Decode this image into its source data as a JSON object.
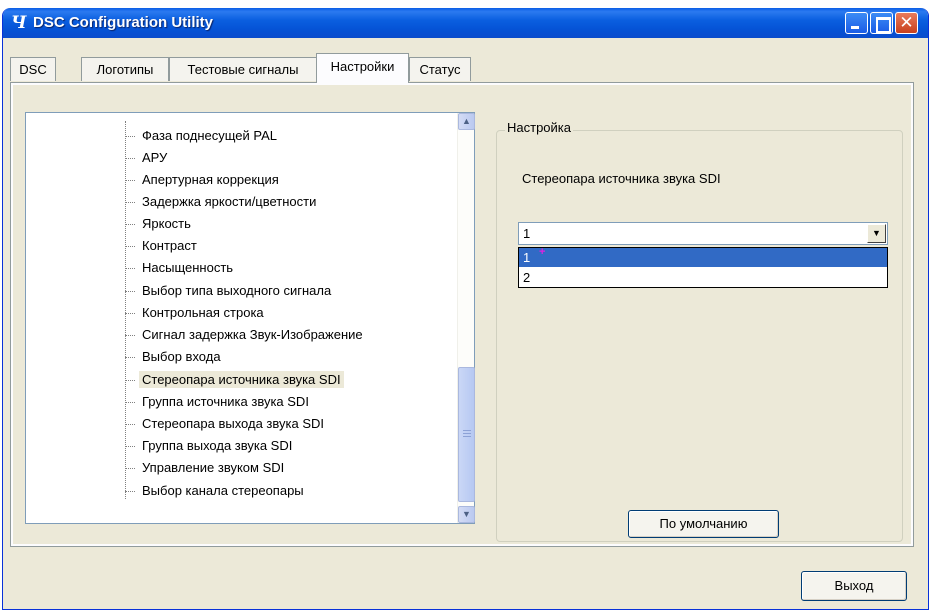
{
  "window": {
    "title": "DSC Configuration Utility",
    "app_icon_glyph": "𝟒"
  },
  "tabs": [
    {
      "label": "DSC"
    },
    {
      "label": "Логотипы"
    },
    {
      "label": "Тестовые сигналы"
    },
    {
      "label": "Настройки",
      "active": true
    },
    {
      "label": "Статус"
    }
  ],
  "tree": {
    "items": [
      {
        "label": "Фаза поднесущей PAL"
      },
      {
        "label": "АРУ"
      },
      {
        "label": "Апертурная коррекция"
      },
      {
        "label": "Задержка яркости/цветности"
      },
      {
        "label": "Яркость"
      },
      {
        "label": "Контраст"
      },
      {
        "label": "Насыщенность"
      },
      {
        "label": "Выбор типа выходного сигнала"
      },
      {
        "label": "Контрольная строка"
      },
      {
        "label": "Сигнал задержка Звук-Изображение"
      },
      {
        "label": "Выбор входа"
      },
      {
        "label": "Стереопара источника звука SDI",
        "selected": true
      },
      {
        "label": "Группа источника звука SDI"
      },
      {
        "label": "Стереопара выхода звука SDI"
      },
      {
        "label": "Группа выхода звука SDI"
      },
      {
        "label": "Управление звуком SDI"
      },
      {
        "label": "Выбор канала стереопары"
      }
    ]
  },
  "settings": {
    "group_title": "Настройка",
    "field_label": "Стереопара источника звука SDI",
    "combo_value": "1",
    "options": [
      "1",
      "2"
    ],
    "selected_option": "1",
    "default_button": "По умолчанию"
  },
  "footer": {
    "exit_button": "Выход"
  },
  "colors": {
    "titlebar": "#0553d6",
    "selection": "#316ac5",
    "window_bg": "#ece9d8"
  }
}
